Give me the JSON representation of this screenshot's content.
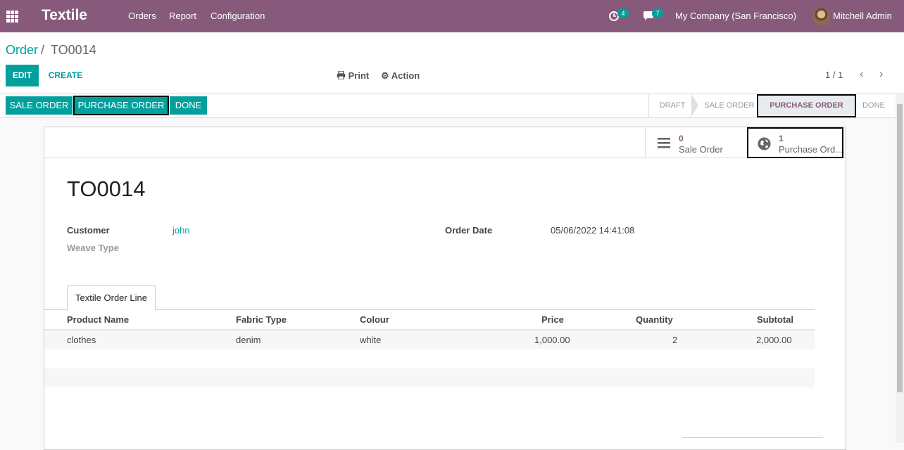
{
  "navbar": {
    "app_name": "Textile",
    "menu": [
      "Orders",
      "Report",
      "Configuration"
    ],
    "activity_badge": "4",
    "messages_badge": "7",
    "company": "My Company (San Francisco)",
    "user": "Mitchell Admin"
  },
  "breadcrumb": {
    "parent": "Order",
    "separator": "/",
    "current": "TO0014"
  },
  "buttons": {
    "edit": "EDIT",
    "create": "CREATE",
    "print": "Print",
    "action": "Action"
  },
  "pager": "1 / 1",
  "statusbar": {
    "buttons": [
      "SALE ORDER",
      "PURCHASE ORDER",
      "DONE"
    ],
    "stages": [
      "DRAFT",
      "SALE ORDER",
      "PURCHASE ORDER",
      "DONE"
    ],
    "current_stage": "PURCHASE ORDER"
  },
  "smart_buttons": [
    {
      "value": "0",
      "label": "Sale Order",
      "icon": "list-icon"
    },
    {
      "value": "1",
      "label": "Purchase Ord...",
      "icon": "globe-icon"
    }
  ],
  "record": {
    "title": "TO0014",
    "customer_label": "Customer",
    "customer": "john",
    "weave_label": "Weave Type",
    "order_date_label": "Order Date",
    "order_date": "05/06/2022 14:41:08"
  },
  "tab": "Textile Order Line",
  "lines": {
    "headers": [
      "Product Name",
      "Fabric Type",
      "Colour",
      "Price",
      "Quantity",
      "Subtotal"
    ],
    "rows": [
      {
        "product": "clothes",
        "fabric": "denim",
        "colour": "white",
        "price": "1,000.00",
        "qty": "2",
        "subtotal": "2,000.00"
      }
    ]
  },
  "colors": {
    "brand": "#875a7b",
    "accent": "#00a09d"
  }
}
